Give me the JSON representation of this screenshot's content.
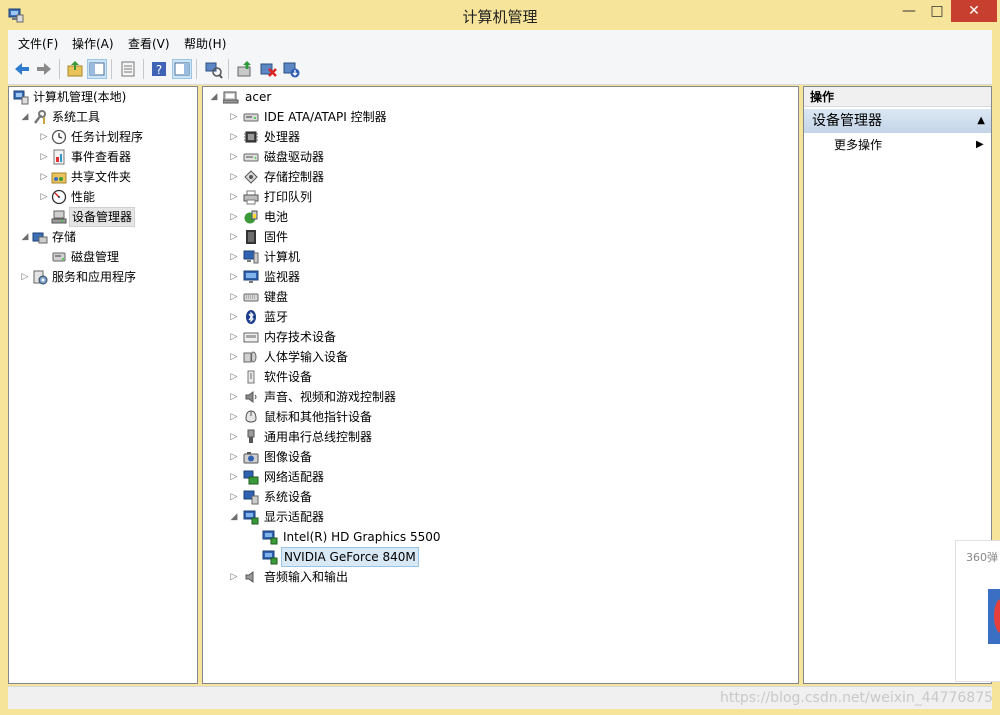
{
  "window": {
    "title": "计算机管理"
  },
  "menu": [
    "文件(F)",
    "操作(A)",
    "查看(V)",
    "帮助(H)"
  ],
  "toolbar": [
    "back-icon",
    "forward-icon",
    "up-folder-icon",
    "show-hide-tree-icon",
    "properties-icon",
    "help-icon",
    "show-hide-action-pane-icon",
    "scan-hardware-icon",
    "update-driver-icon",
    "disable-device-icon",
    "uninstall-device-icon"
  ],
  "left_tree": [
    {
      "label": "计算机管理(本地)",
      "icon": "computer-management-icon",
      "level": 0,
      "expander": ""
    },
    {
      "label": "系统工具",
      "icon": "system-tools-icon",
      "level": 1,
      "expander": "expanded"
    },
    {
      "label": "任务计划程序",
      "icon": "task-scheduler-icon",
      "level": 2,
      "expander": "collapsed"
    },
    {
      "label": "事件查看器",
      "icon": "event-viewer-icon",
      "level": 2,
      "expander": "collapsed"
    },
    {
      "label": "共享文件夹",
      "icon": "shared-folders-icon",
      "level": 2,
      "expander": "collapsed"
    },
    {
      "label": "性能",
      "icon": "performance-icon",
      "level": 2,
      "expander": "collapsed"
    },
    {
      "label": "设备管理器",
      "icon": "device-manager-icon",
      "level": 2,
      "expander": "",
      "selected": true
    },
    {
      "label": "存储",
      "icon": "storage-icon",
      "level": 1,
      "expander": "expanded"
    },
    {
      "label": "磁盘管理",
      "icon": "disk-management-icon",
      "level": 2,
      "expander": ""
    },
    {
      "label": "服务和应用程序",
      "icon": "services-applications-icon",
      "level": 1,
      "expander": "collapsed"
    }
  ],
  "device_tree": {
    "root": "acer",
    "categories": [
      {
        "label": "IDE ATA/ATAPI 控制器",
        "icon": "ide-controller-icon",
        "expander": "collapsed"
      },
      {
        "label": "处理器",
        "icon": "processor-icon",
        "expander": "collapsed"
      },
      {
        "label": "磁盘驱动器",
        "icon": "disk-drive-icon",
        "expander": "collapsed"
      },
      {
        "label": "存储控制器",
        "icon": "storage-controller-icon",
        "expander": "collapsed"
      },
      {
        "label": "打印队列",
        "icon": "printer-icon",
        "expander": "collapsed"
      },
      {
        "label": "电池",
        "icon": "battery-icon",
        "expander": "collapsed"
      },
      {
        "label": "固件",
        "icon": "firmware-icon",
        "expander": "collapsed"
      },
      {
        "label": "计算机",
        "icon": "computer-icon",
        "expander": "collapsed"
      },
      {
        "label": "监视器",
        "icon": "monitor-icon",
        "expander": "collapsed"
      },
      {
        "label": "键盘",
        "icon": "keyboard-icon",
        "expander": "collapsed"
      },
      {
        "label": "蓝牙",
        "icon": "bluetooth-icon",
        "expander": "collapsed"
      },
      {
        "label": "内存技术设备",
        "icon": "memory-device-icon",
        "expander": "collapsed"
      },
      {
        "label": "人体学输入设备",
        "icon": "hid-icon",
        "expander": "collapsed"
      },
      {
        "label": "软件设备",
        "icon": "software-device-icon",
        "expander": "collapsed"
      },
      {
        "label": "声音、视频和游戏控制器",
        "icon": "sound-icon",
        "expander": "collapsed"
      },
      {
        "label": "鼠标和其他指针设备",
        "icon": "mouse-icon",
        "expander": "collapsed"
      },
      {
        "label": "通用串行总线控制器",
        "icon": "usb-icon",
        "expander": "collapsed"
      },
      {
        "label": "图像设备",
        "icon": "camera-icon",
        "expander": "collapsed"
      },
      {
        "label": "网络适配器",
        "icon": "network-adapter-icon",
        "expander": "collapsed"
      },
      {
        "label": "系统设备",
        "icon": "system-device-icon",
        "expander": "collapsed"
      },
      {
        "label": "显示适配器",
        "icon": "display-adapter-icon",
        "expander": "expanded",
        "children": [
          {
            "label": "Intel(R) HD Graphics 5500",
            "icon": "display-adapter-icon"
          },
          {
            "label": "NVIDIA GeForce 840M",
            "icon": "display-adapter-icon",
            "selected": true
          }
        ]
      },
      {
        "label": "音频输入和输出",
        "icon": "audio-io-icon",
        "expander": "collapsed"
      }
    ]
  },
  "actions": {
    "header": "操作",
    "group": "设备管理器",
    "item": "更多操作"
  },
  "overlay": {
    "watermark": "https://blog.csdn.net/weixin_44776875",
    "popup_text": "360弹"
  },
  "colors": {
    "titlebar": "#f6e49b",
    "close": "#c7402f",
    "selection": "#d9e8f5",
    "action_group": "#c3d5e8"
  }
}
